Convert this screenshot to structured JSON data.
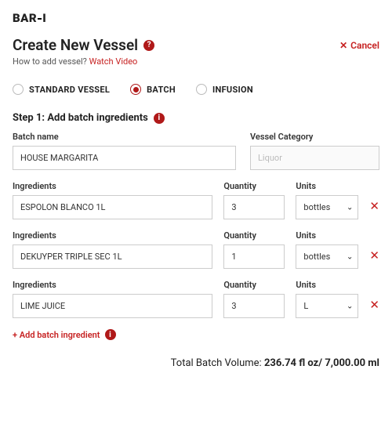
{
  "logo": "BAR-I",
  "title": "Create New Vessel",
  "sub_prefix": "How to add vessel? ",
  "sub_link": "Watch Video",
  "cancel": "Cancel",
  "vessel_types": [
    {
      "label": "STANDARD VESSEL",
      "selected": false
    },
    {
      "label": "BATCH",
      "selected": true
    },
    {
      "label": "INFUSION",
      "selected": false
    }
  ],
  "step_title": "Step 1: Add batch ingredients",
  "labels": {
    "batch_name": "Batch name",
    "vessel_category": "Vessel Category",
    "ingredients": "Ingredients",
    "quantity": "Quantity",
    "units": "Units"
  },
  "batch_name": "HOUSE MARGARITA",
  "vessel_category_placeholder": "Liquor",
  "rows": [
    {
      "ingredient": "ESPOLON BLANCO 1L",
      "qty": "3",
      "unit": "bottles"
    },
    {
      "ingredient": "DEKUYPER TRIPLE SEC 1L",
      "qty": "1",
      "unit": "bottles"
    },
    {
      "ingredient": "LIME JUICE",
      "qty": "3",
      "unit": "L"
    }
  ],
  "add_label": "+ Add batch ingredient",
  "total_label": "Total Batch Volume: ",
  "total_value": "236.74 fl oz/ 7,000.00 ml"
}
